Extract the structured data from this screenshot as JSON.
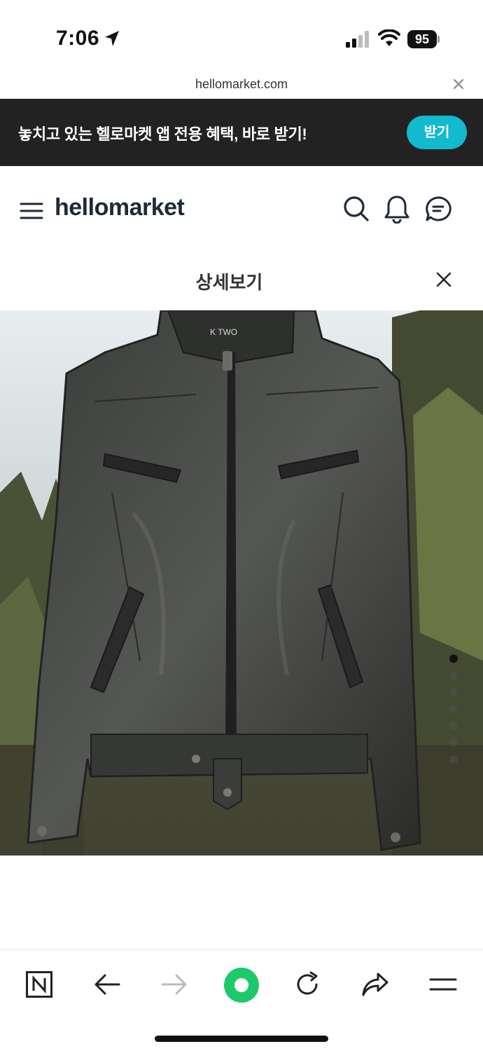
{
  "status_bar": {
    "time": "7:06",
    "battery": "95"
  },
  "browser": {
    "url": "hellomarket.com"
  },
  "banner": {
    "text": "놓치고 있는 헬로마켓 앱 전용 혜택, 바로 받기!",
    "button_label": "받기",
    "button_color": "#12b9cf"
  },
  "header": {
    "logo": "hellomarket"
  },
  "detail": {
    "title": "상세보기"
  },
  "product_image": {
    "alt": "black leather jacket",
    "label_text": "K TWO",
    "pager": {
      "current": 1,
      "total": 7
    }
  },
  "toolbar": {
    "items": [
      "naver-icon",
      "back-icon",
      "forward-icon",
      "green-dot-icon",
      "refresh-icon",
      "share-icon",
      "menu-icon"
    ]
  }
}
